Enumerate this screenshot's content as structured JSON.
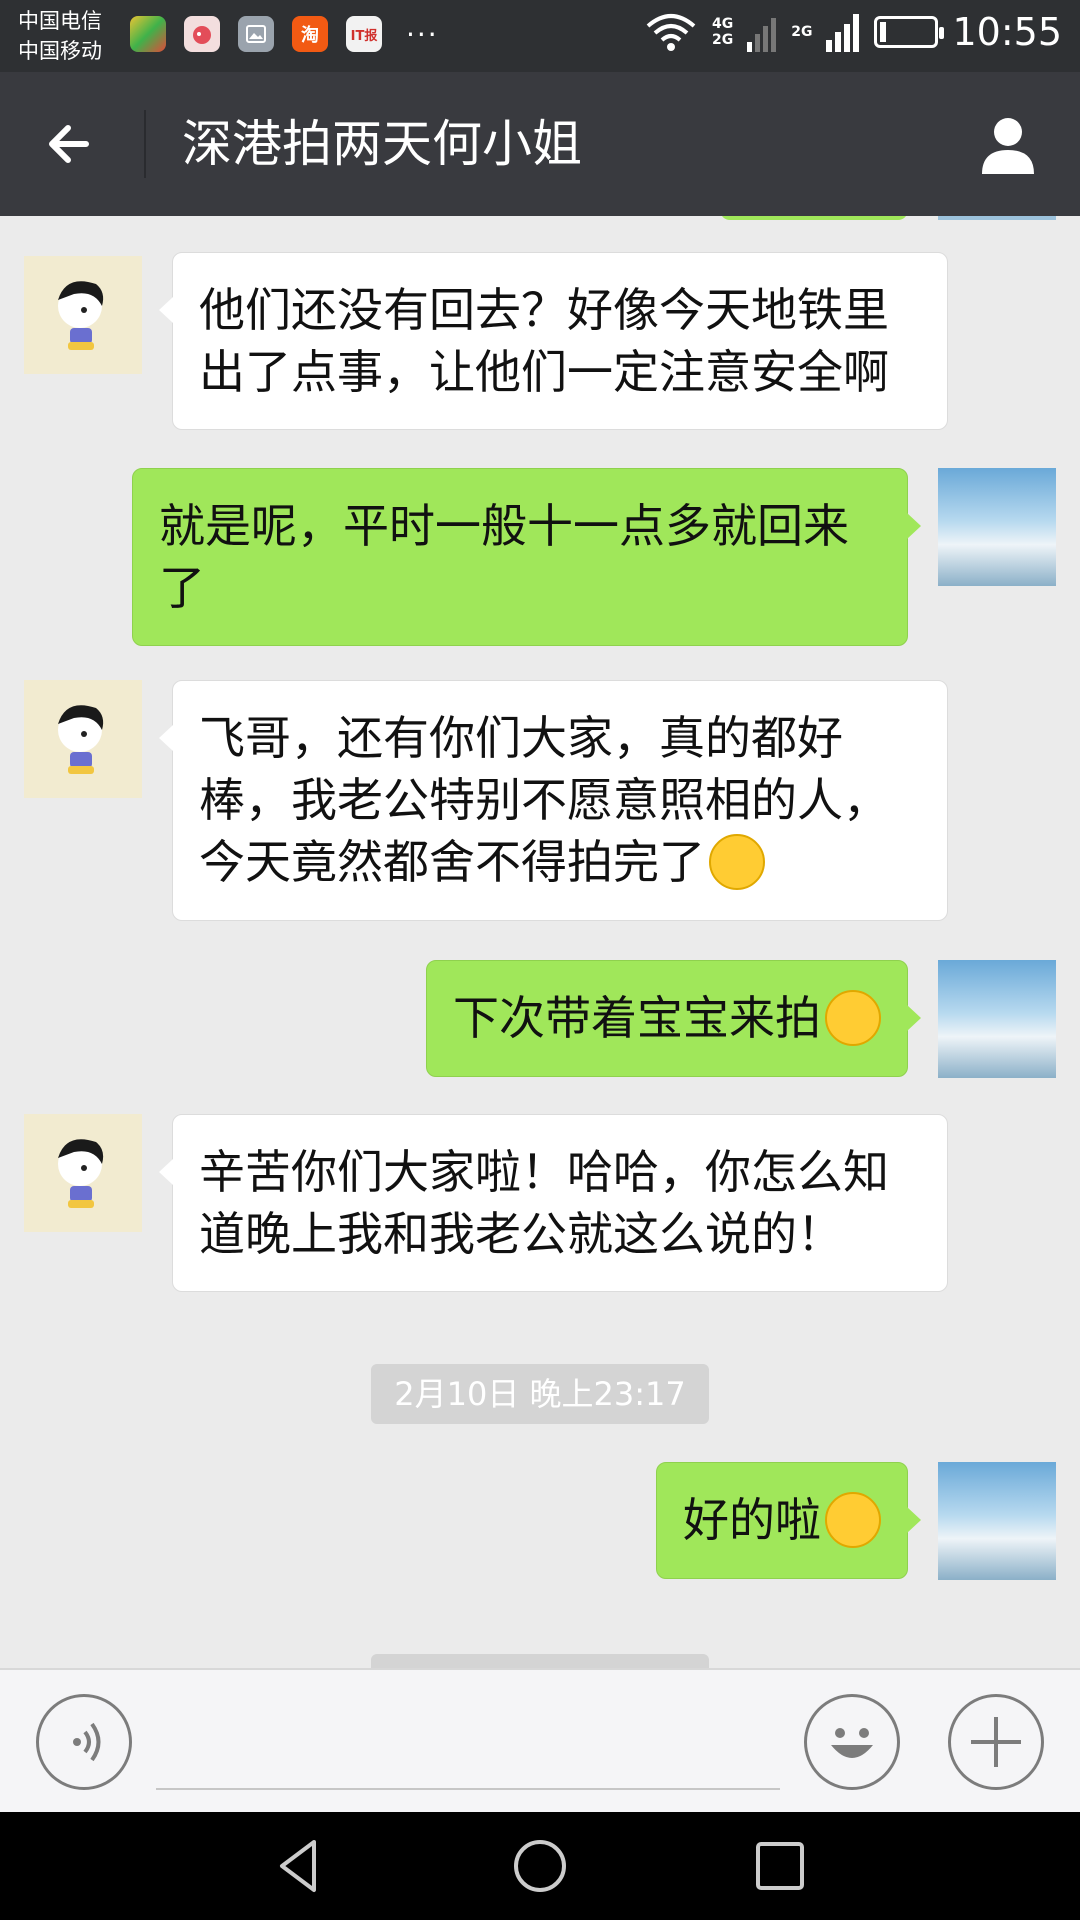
{
  "status_bar": {
    "carrier_1": "中国电信",
    "carrier_2": "中国移动",
    "app_icons": [
      "browser-icon",
      "weibo-icon",
      "gallery-icon",
      "taobao-icon",
      "news-icon"
    ],
    "taobao_label": "淘",
    "news_label": "IT报",
    "more": "···",
    "net_1": "4G",
    "net_2": "2G",
    "net_3": "2G",
    "time": "10:55"
  },
  "title_bar": {
    "title": "深港拍两天何小姐"
  },
  "messages": [
    {
      "from": "other",
      "text": "他们还没有回去？好像今天地铁里出了点事，让他们一定注意安全啊"
    },
    {
      "from": "me",
      "text": "就是呢，平时一般十一点多就回来了"
    },
    {
      "from": "other",
      "text": "飞哥，还有你们大家，真的都好棒，我老公特别不愿意照相的人，今天竟然都舍不得拍完了",
      "emoji": "laughing-tears-emoji"
    },
    {
      "from": "me",
      "text": "下次带着宝宝来拍",
      "emoji": "grinning-emoji"
    },
    {
      "from": "other",
      "text": "辛苦你们大家啦！哈哈，你怎么知道晚上我和我老公就这么说的！"
    },
    {
      "from": "me",
      "text": "好的啦",
      "emoji": "smiling-emoji"
    }
  ],
  "timestamp": "2月10日 晚上23:17",
  "colors": {
    "title_bar": "#393a3f",
    "status_bar": "#2e3033",
    "bubble_me": "#a0e75a",
    "bubble_other": "#ffffff",
    "chat_bg": "#ebebeb"
  },
  "input_bar": {
    "icons": [
      "voice-icon",
      "emoji-icon",
      "plus-icon"
    ]
  }
}
